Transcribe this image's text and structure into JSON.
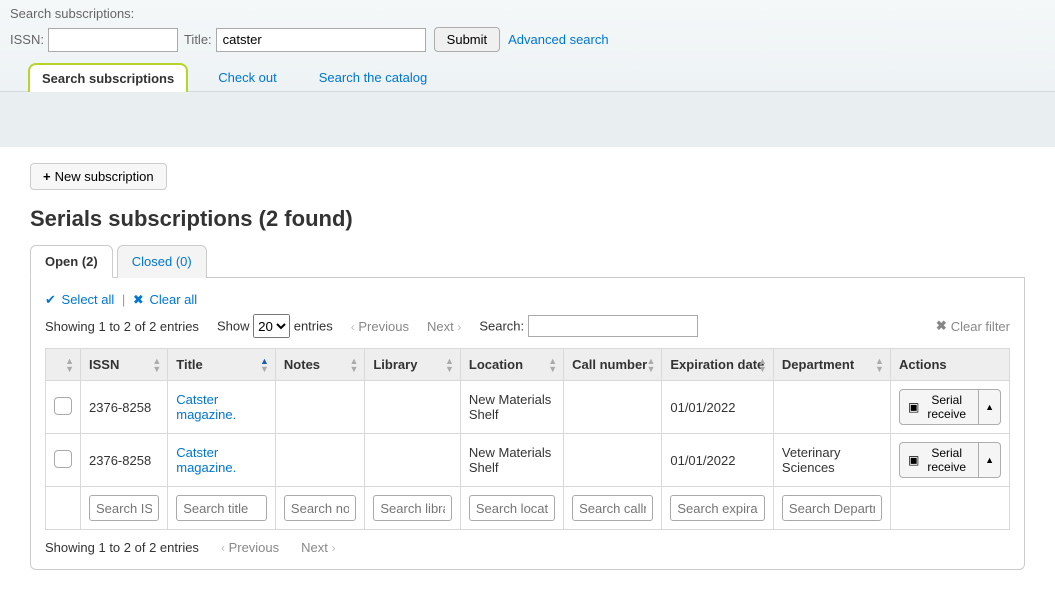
{
  "searchbar": {
    "title": "Search subscriptions:",
    "issn_label": "ISSN:",
    "issn_value": "",
    "title_label": "Title:",
    "title_value": "catster",
    "submit": "Submit",
    "advanced": "Advanced search"
  },
  "module_tabs": {
    "active": "Search subscriptions",
    "checkout": "Check out",
    "search_catalog": "Search the catalog"
  },
  "toolbar": {
    "new_subscription": "New subscription"
  },
  "heading": "Serials subscriptions (2 found)",
  "state_tabs": {
    "open": "Open (2)",
    "closed": "Closed (0)"
  },
  "selection": {
    "select_all": "Select all",
    "clear_all": "Clear all"
  },
  "datatable_controls": {
    "showing_top": "Showing 1 to 2 of 2 entries",
    "show_label": "Show",
    "show_value": "20",
    "entries_label": "entries",
    "previous": "Previous",
    "next": "Next",
    "search_label": "Search:",
    "search_value": "",
    "clear_filter": "Clear filter",
    "showing_bottom": "Showing 1 to 2 of 2 entries"
  },
  "columns": {
    "check": "",
    "issn": "ISSN",
    "title": "Title",
    "notes": "Notes",
    "library": "Library",
    "location": "Location",
    "callnumber": "Call number",
    "expiration": "Expiration date",
    "department": "Department",
    "actions": "Actions"
  },
  "rows": [
    {
      "issn": "2376-8258",
      "title": "Catster magazine.",
      "notes": "",
      "library": "",
      "location": "New Materials Shelf",
      "callnumber": "",
      "expiration": "01/01/2022",
      "department": "",
      "action": "Serial receive"
    },
    {
      "issn": "2376-8258",
      "title": "Catster magazine.",
      "notes": "",
      "library": "",
      "location": "New Materials Shelf",
      "callnumber": "",
      "expiration": "01/01/2022",
      "department": "Veterinary Sciences",
      "action": "Serial receive"
    }
  ],
  "column_filters": {
    "issn": "Search ISSN",
    "title": "Search title",
    "notes": "Search not",
    "library": "Search libra",
    "location": "Search locatio",
    "callnumber": "Search callnu",
    "expiration": "Search expirati",
    "department": "Search Departme"
  }
}
